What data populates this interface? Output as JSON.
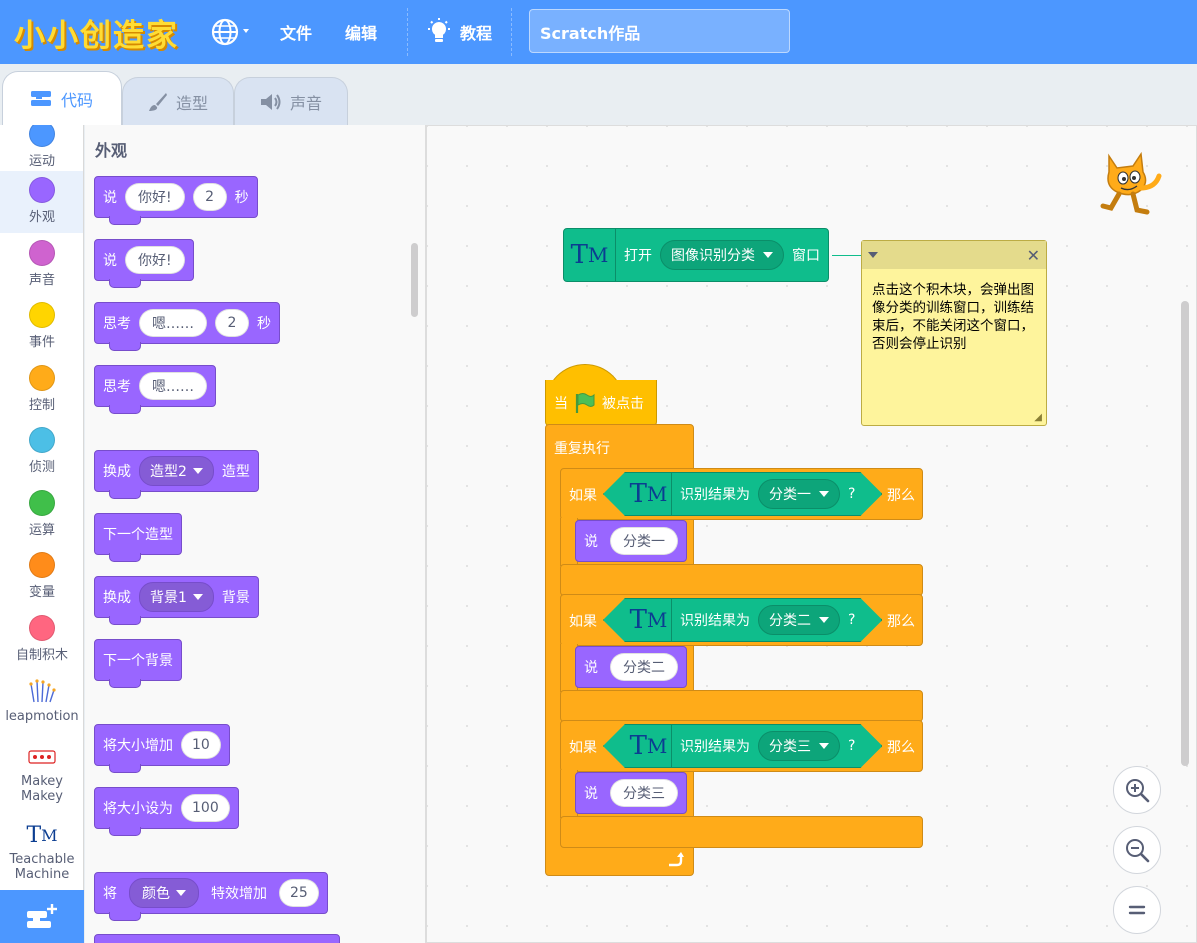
{
  "app": {
    "brand": "小小创造家"
  },
  "menu": {
    "file": "文件",
    "edit": "编辑",
    "tutorial": "教程",
    "project_title": "Scratch作品"
  },
  "tabs": {
    "code": "代码",
    "costumes": "造型",
    "sounds": "声音"
  },
  "categories": [
    {
      "label": "运动",
      "color": "#4c97ff"
    },
    {
      "label": "外观",
      "color": "#9966ff"
    },
    {
      "label": "声音",
      "color": "#cf63cf"
    },
    {
      "label": "事件",
      "color": "#ffd500"
    },
    {
      "label": "控制",
      "color": "#ffab19"
    },
    {
      "label": "侦测",
      "color": "#4cbfe6"
    },
    {
      "label": "运算",
      "color": "#40bf4a"
    },
    {
      "label": "变量",
      "color": "#ff8c1a"
    },
    {
      "label": "自制积木",
      "color": "#ff6680"
    },
    {
      "label": "leapmotion"
    },
    {
      "label1": "Makey",
      "label2": "Makey"
    },
    {
      "label1": "Teachable",
      "label2": "Machine"
    }
  ],
  "palette": {
    "title": "外观",
    "say_secs": {
      "say": "说",
      "msg": "你好!",
      "secs": "2",
      "unit": "秒"
    },
    "say": {
      "say": "说",
      "msg": "你好!"
    },
    "think_secs": {
      "think": "思考",
      "msg": "嗯……",
      "secs": "2",
      "unit": "秒"
    },
    "think": {
      "think": "思考",
      "msg": "嗯……"
    },
    "switch_costume": {
      "label": "换成",
      "value": "造型2",
      "suffix": "造型"
    },
    "next_costume": "下一个造型",
    "switch_backdrop": {
      "label": "换成",
      "value": "背景1",
      "suffix": "背景"
    },
    "next_backdrop": "下一个背景",
    "change_size": {
      "label": "将大小增加",
      "value": "10"
    },
    "set_size": {
      "label": "将大小设为",
      "value": "100"
    },
    "change_effect": {
      "label": "将",
      "effect": "颜色",
      "suffix": "特效增加",
      "value": "25"
    }
  },
  "workspace": {
    "open_block": {
      "tm": "T",
      "tm_small": "M",
      "open": "打开",
      "window_name": "图像识别分类",
      "window": "窗口"
    },
    "comment": {
      "text": "点击这个积木块，会弹出图像分类的训练窗口，训练结束后，不能关闭这个窗口，否则会停止识别"
    },
    "script": {
      "when": "当",
      "clicked": "被点击",
      "forever": "重复执行",
      "branches": [
        {
          "if": "如果",
          "cond": "识别结果为",
          "cls": "分类一",
          "q": "?",
          "then": "那么",
          "say": "说",
          "msg": "分类一"
        },
        {
          "if": "如果",
          "cond": "识别结果为",
          "cls": "分类二",
          "q": "?",
          "then": "那么",
          "say": "说",
          "msg": "分类二"
        },
        {
          "if": "如果",
          "cond": "识别结果为",
          "cls": "分类三",
          "q": "?",
          "then": "那么",
          "say": "说",
          "msg": "分类三"
        }
      ]
    }
  }
}
